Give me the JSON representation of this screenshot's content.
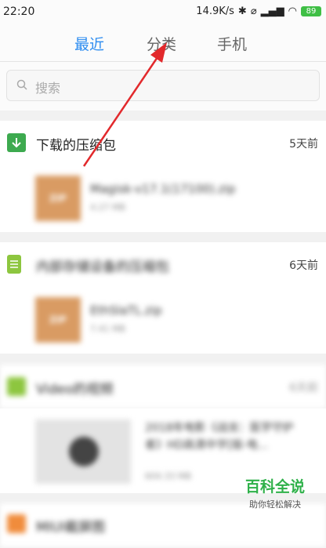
{
  "status_bar": {
    "time": "22:20",
    "network_speed": "14.9K/s",
    "battery_level": "89",
    "battery_color": "#3fbf45"
  },
  "tabs": [
    {
      "label": "最近",
      "active": true
    },
    {
      "label": "分类",
      "active": false
    },
    {
      "label": "手机",
      "active": false
    }
  ],
  "search": {
    "placeholder": "搜索"
  },
  "sections": [
    {
      "title": "下载的压缩包",
      "time": "5天前",
      "icon": "download-icon",
      "icon_color": "#3daa4f",
      "file": {
        "thumb_label": "ZIP",
        "name": "Magisk-v17.1(17100).zip",
        "size": "4.27 MB"
      }
    },
    {
      "title": "内部存储设备的压缩包",
      "time": "6天前",
      "icon": "document-icon",
      "icon_color": "#8dc63f",
      "file": {
        "thumb_label": "ZIP",
        "name": "EthSlaTL.zip",
        "size": "7.41 MB"
      }
    },
    {
      "title": "Video的视频",
      "time": "6天前",
      "icon": "video-folder-icon",
      "icon_color": "#8dc63f",
      "file": {
        "name": "2018年电影《战龙：医学守护者》HD高清中字[版-电...",
        "size": "604.33 MB"
      }
    },
    {
      "title": "MIUI截屏图",
      "icon": "image-folder-icon",
      "icon_color": "#f08c3c"
    }
  ],
  "watermark": {
    "title": "百科全说",
    "subtitle": "助你轻松解决"
  },
  "annotation": {
    "arrow_color": "#e2292c"
  }
}
